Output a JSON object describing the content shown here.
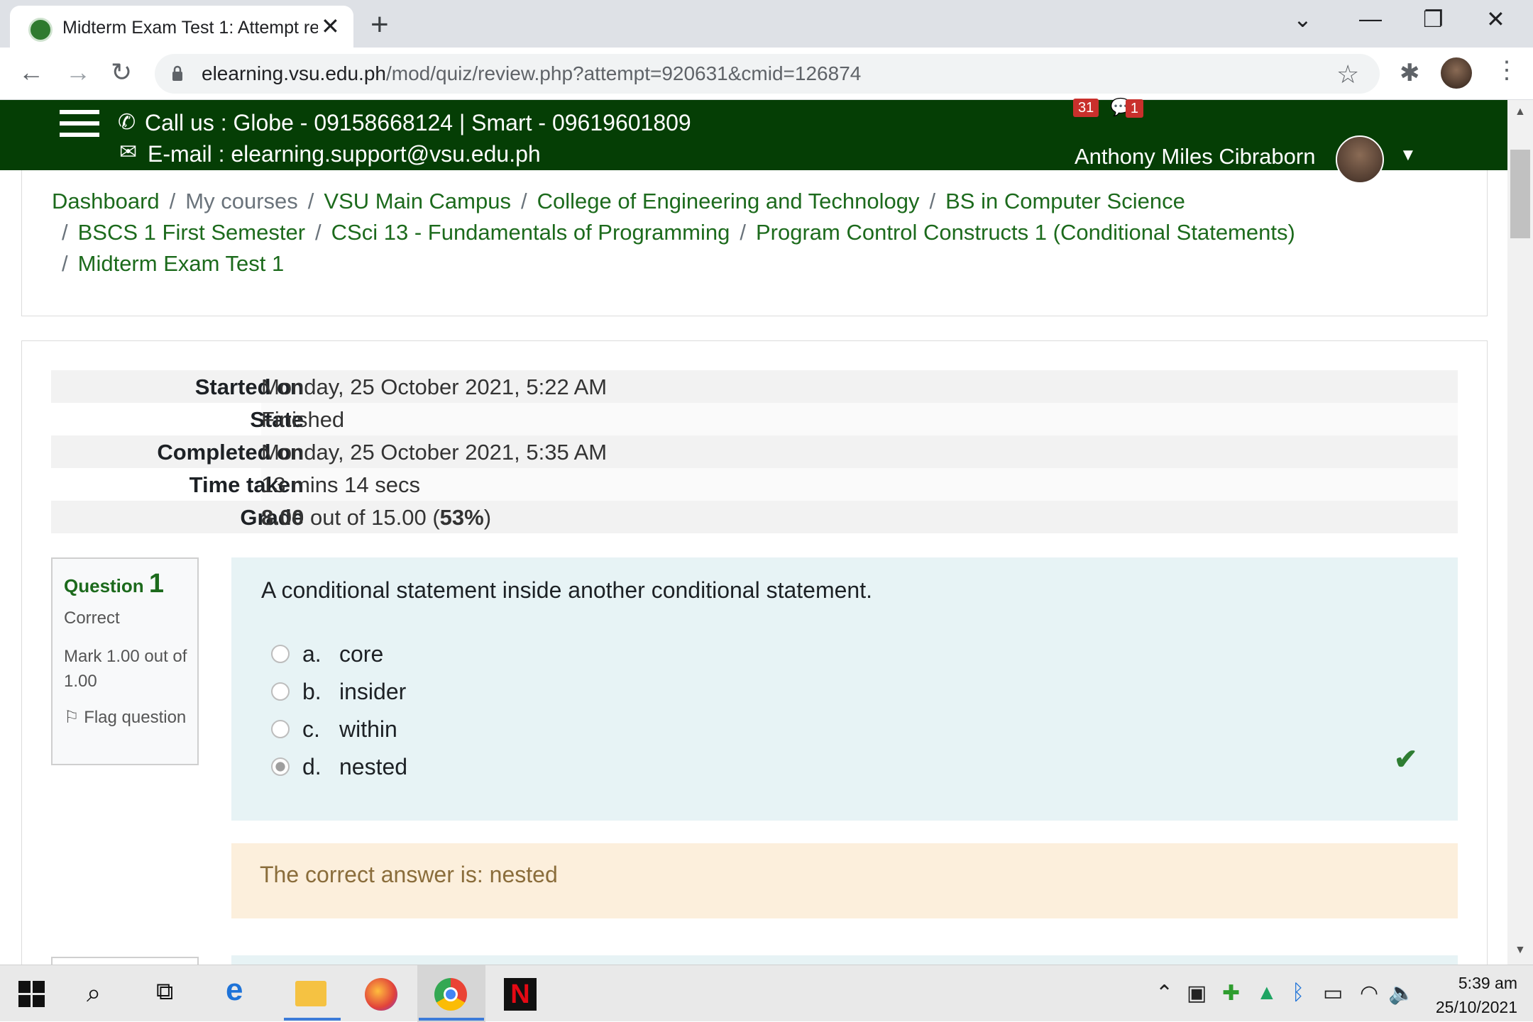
{
  "browser": {
    "tab_title": "Midterm Exam Test 1: Attempt re",
    "url_host": "elearning.vsu.edu.ph",
    "url_path": "/mod/quiz/review.php?attempt=920631&cmid=126874"
  },
  "header": {
    "call_us": "Call us : Globe - 09158668124 | Smart - 09619601809",
    "email": "E-mail : elearning.support@vsu.edu.ph",
    "notifications_count": "31",
    "messages_count": "1",
    "user_name": "Anthony Miles Cibraborn"
  },
  "breadcrumb": {
    "items": [
      "Dashboard",
      "My courses",
      "VSU Main Campus",
      "College of Engineering and Technology",
      "BS in Computer Science",
      "BSCS 1 First Semester",
      "CSci 13 - Fundamentals of Programming",
      "Program Control Constructs 1 (Conditional Statements)",
      "Midterm Exam Test 1"
    ]
  },
  "summary": {
    "rows": [
      {
        "label": "Started on",
        "value": "Monday, 25 October 2021, 5:22 AM"
      },
      {
        "label": "State",
        "value": "Finished"
      },
      {
        "label": "Completed on",
        "value": "Monday, 25 October 2021, 5:35 AM"
      },
      {
        "label": "Time taken",
        "value": "13 mins 14 secs"
      },
      {
        "label": "Grade",
        "value_bold": "8.00",
        "value_mid": " out of 15.00 (",
        "value_pct": "53%",
        "value_end": ")"
      }
    ]
  },
  "question": {
    "label": "Question",
    "number": "1",
    "state": "Correct",
    "mark": "Mark 1.00 out of 1.00",
    "flag": "Flag question",
    "text": "A conditional statement inside another conditional statement.",
    "options": [
      {
        "letter": "a.",
        "text": "core",
        "selected": false
      },
      {
        "letter": "b.",
        "text": "insider",
        "selected": false
      },
      {
        "letter": "c.",
        "text": "within",
        "selected": false
      },
      {
        "letter": "d.",
        "text": "nested",
        "selected": true
      }
    ],
    "feedback": "The correct answer is: nested"
  },
  "taskbar": {
    "time": "5:39 am",
    "date": "25/10/2021"
  },
  "colors": {
    "header_bg": "#053e05",
    "link_green": "#1c6a1c",
    "question_bg": "#e7f3f5",
    "feedback_bg": "#fcefdc"
  }
}
